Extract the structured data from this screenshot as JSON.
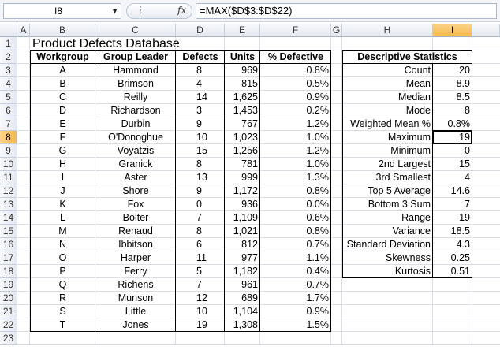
{
  "formula_bar": {
    "name_box": "I8",
    "fx_label": "fx",
    "formula": "=MAX($D$3:$D$22)"
  },
  "columns": [
    "A",
    "B",
    "C",
    "D",
    "E",
    "F",
    "G",
    "H",
    "I"
  ],
  "rows": [
    "1",
    "2",
    "3",
    "4",
    "5",
    "6",
    "7",
    "8",
    "9",
    "10",
    "11",
    "12",
    "13",
    "14",
    "15",
    "16",
    "17",
    "18",
    "19",
    "20",
    "21",
    "22",
    "23"
  ],
  "active_cell": {
    "column": "I",
    "row": "8"
  },
  "sheet": {
    "title": "Product Defects Database",
    "table_headers": [
      "Workgroup",
      "Group Leader",
      "Defects",
      "Units",
      "% Defective"
    ],
    "table_rows": [
      [
        "A",
        "Hammond",
        "8",
        "969",
        "0.8%"
      ],
      [
        "B",
        "Brimson",
        "4",
        "815",
        "0.5%"
      ],
      [
        "C",
        "Reilly",
        "14",
        "1,625",
        "0.9%"
      ],
      [
        "D",
        "Richardson",
        "3",
        "1,453",
        "0.2%"
      ],
      [
        "E",
        "Durbin",
        "9",
        "767",
        "1.2%"
      ],
      [
        "F",
        "O'Donoghue",
        "10",
        "1,023",
        "1.0%"
      ],
      [
        "G",
        "Voyatzis",
        "15",
        "1,256",
        "1.2%"
      ],
      [
        "H",
        "Granick",
        "8",
        "781",
        "1.0%"
      ],
      [
        "I",
        "Aster",
        "13",
        "999",
        "1.3%"
      ],
      [
        "J",
        "Shore",
        "9",
        "1,172",
        "0.8%"
      ],
      [
        "K",
        "Fox",
        "0",
        "936",
        "0.0%"
      ],
      [
        "L",
        "Bolter",
        "7",
        "1,109",
        "0.6%"
      ],
      [
        "M",
        "Renaud",
        "8",
        "1,021",
        "0.8%"
      ],
      [
        "N",
        "Ibbitson",
        "6",
        "812",
        "0.7%"
      ],
      [
        "O",
        "Harper",
        "11",
        "977",
        "1.1%"
      ],
      [
        "P",
        "Ferry",
        "5",
        "1,182",
        "0.4%"
      ],
      [
        "Q",
        "Richens",
        "7",
        "961",
        "0.7%"
      ],
      [
        "R",
        "Munson",
        "12",
        "689",
        "1.7%"
      ],
      [
        "S",
        "Little",
        "10",
        "1,104",
        "0.9%"
      ],
      [
        "T",
        "Jones",
        "19",
        "1,308",
        "1.5%"
      ]
    ],
    "stats_header": "Descriptive Statistics",
    "stats": [
      [
        "Count",
        "20"
      ],
      [
        "Mean",
        "8.9"
      ],
      [
        "Median",
        "8.5"
      ],
      [
        "Mode",
        "8"
      ],
      [
        "Weighted Mean %",
        "0.8%"
      ],
      [
        "Maximum",
        "19"
      ],
      [
        "Minimum",
        "0"
      ],
      [
        "2nd Largest",
        "15"
      ],
      [
        "3rd Smallest",
        "4"
      ],
      [
        "Top 5 Average",
        "14.6"
      ],
      [
        "Bottom 3 Sum",
        "7"
      ],
      [
        "Range",
        "19"
      ],
      [
        "Variance",
        "18.5"
      ],
      [
        "Standard Deviation",
        "4.3"
      ],
      [
        "Skewness",
        "0.25"
      ],
      [
        "Kurtosis",
        "0.51"
      ]
    ]
  }
}
